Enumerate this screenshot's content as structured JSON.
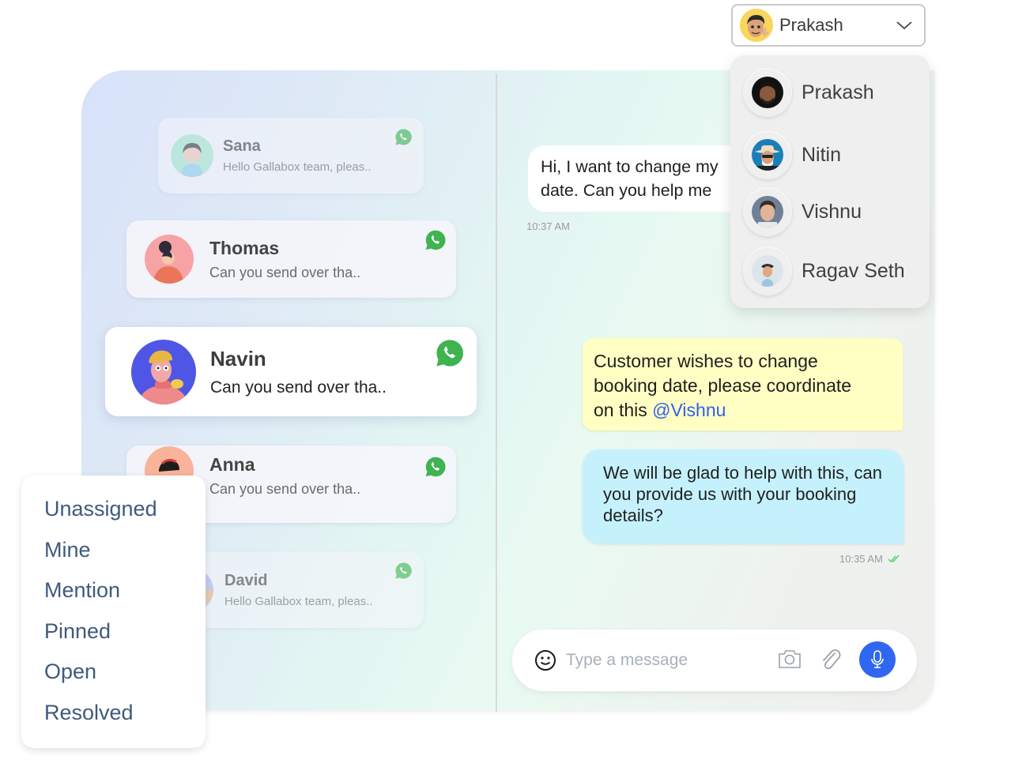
{
  "agent_selector": {
    "selected": "Prakash",
    "options": [
      {
        "name": "Prakash",
        "avatar": "photo-dark-bg"
      },
      {
        "name": "Nitin",
        "avatar": "photo-hat-blue-bg"
      },
      {
        "name": "Vishnu",
        "avatar": "photo-gray-bg"
      },
      {
        "name": "Ragav Seth",
        "avatar": "photo-light-bg"
      }
    ]
  },
  "conversations": [
    {
      "name": "Sana",
      "preview": "Hello Gallabox team, pleas..",
      "channel": "whatsapp-icon",
      "state": "faded"
    },
    {
      "name": "Thomas",
      "preview": "Can you send over tha..",
      "channel": "whatsapp-icon",
      "state": "normal"
    },
    {
      "name": "Navin",
      "preview": "Can you send over tha..",
      "channel": "whatsapp-icon",
      "state": "active"
    },
    {
      "name": "Anna",
      "preview": "Can you send over tha..",
      "channel": "whatsapp-icon",
      "state": "normal"
    },
    {
      "name": "David",
      "preview": "Hello Gallabox team, pleas..",
      "channel": "whatsapp-icon",
      "state": "faded"
    }
  ],
  "filters": [
    "Unassigned",
    "Mine",
    "Mention",
    "Pinned",
    "Open",
    "Resolved"
  ],
  "messages": {
    "incoming": {
      "line1": "Hi, I want to change my",
      "line2": "date. Can you help me",
      "time": "10:37 AM"
    },
    "internal_note": {
      "text_line1": "Customer wishes to change",
      "text_line2": "booking date, please coordinate",
      "text_prefix": "on this ",
      "mention": "@Vishnu"
    },
    "outgoing": {
      "text": "We will be glad to help with this, can you provide us with your booking details?",
      "time": "10:35 AM",
      "status": "read-double-check"
    }
  },
  "composer": {
    "placeholder": "Type a message",
    "value": ""
  },
  "colors": {
    "whatsapp": "#3fb34f",
    "mic_button": "#3067f1",
    "mention": "#2f5ff0",
    "note_bg": "#ffffc3",
    "outgoing_bg": "#c5f1fd",
    "filter_text": "#3f5a7d",
    "read_check": "#4bd36b"
  }
}
